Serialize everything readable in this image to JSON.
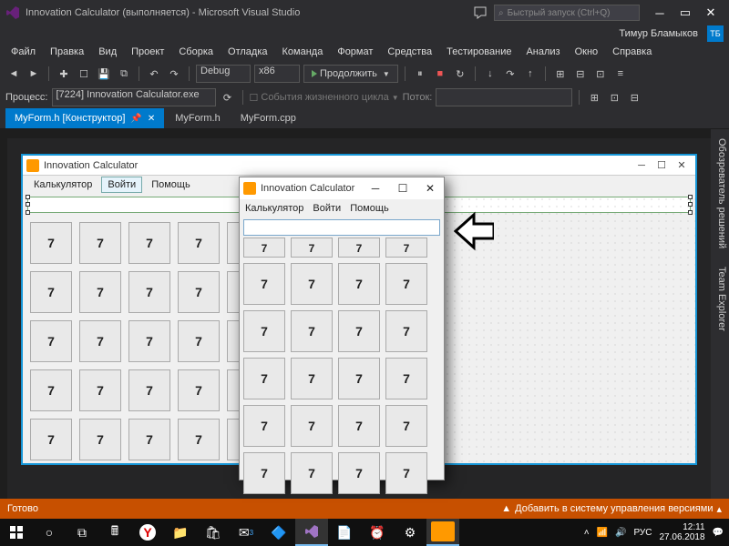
{
  "window": {
    "title": "Innovation Calculator (выполняется) - Microsoft Visual Studio",
    "quick_launch_placeholder": "Быстрый запуск (Ctrl+Q)",
    "user_name": "Тимур Бламыков",
    "user_initials": "ТБ"
  },
  "menu": {
    "items": [
      "Файл",
      "Правка",
      "Вид",
      "Проект",
      "Сборка",
      "Отладка",
      "Команда",
      "Формат",
      "Средства",
      "Тестирование",
      "Анализ",
      "Окно",
      "Справка"
    ]
  },
  "toolbar1": {
    "config": "Debug",
    "platform": "x86",
    "run_label": "Продолжить",
    "process_label": "Процесс:",
    "process_value": "[7224] Innovation Calculator.exe",
    "lifecycle_label": "События жизненного цикла",
    "thread_label": "Поток:"
  },
  "tabs": {
    "items": [
      {
        "label": "MyForm.h [Конструктор]",
        "active": true
      },
      {
        "label": "MyForm.h",
        "active": false
      },
      {
        "label": "MyForm.cpp",
        "active": false
      }
    ]
  },
  "side_tabs": [
    "Обозреватель решений",
    "Team Explorer"
  ],
  "designer_form": {
    "title": "Innovation Calculator",
    "menu": [
      "Калькулятор",
      "Войти",
      "Помощь"
    ],
    "selected_menu_index": 1,
    "button_label": "7",
    "grid_cols": 5,
    "grid_rows": 5
  },
  "run_window": {
    "title": "Innovation Calculator",
    "menu": [
      "Калькулятор",
      "Войти",
      "Помощь"
    ],
    "button_label": "7",
    "grid_cols": 4,
    "peek_row_count": 1,
    "grid_rows": 5
  },
  "statusbar": {
    "ready": "Готово",
    "vcs": "Добавить в систему управления версиями"
  },
  "taskbar": {
    "lang": "РУС",
    "time": "12:11",
    "date": "27.06.2018",
    "notifications": "3"
  }
}
